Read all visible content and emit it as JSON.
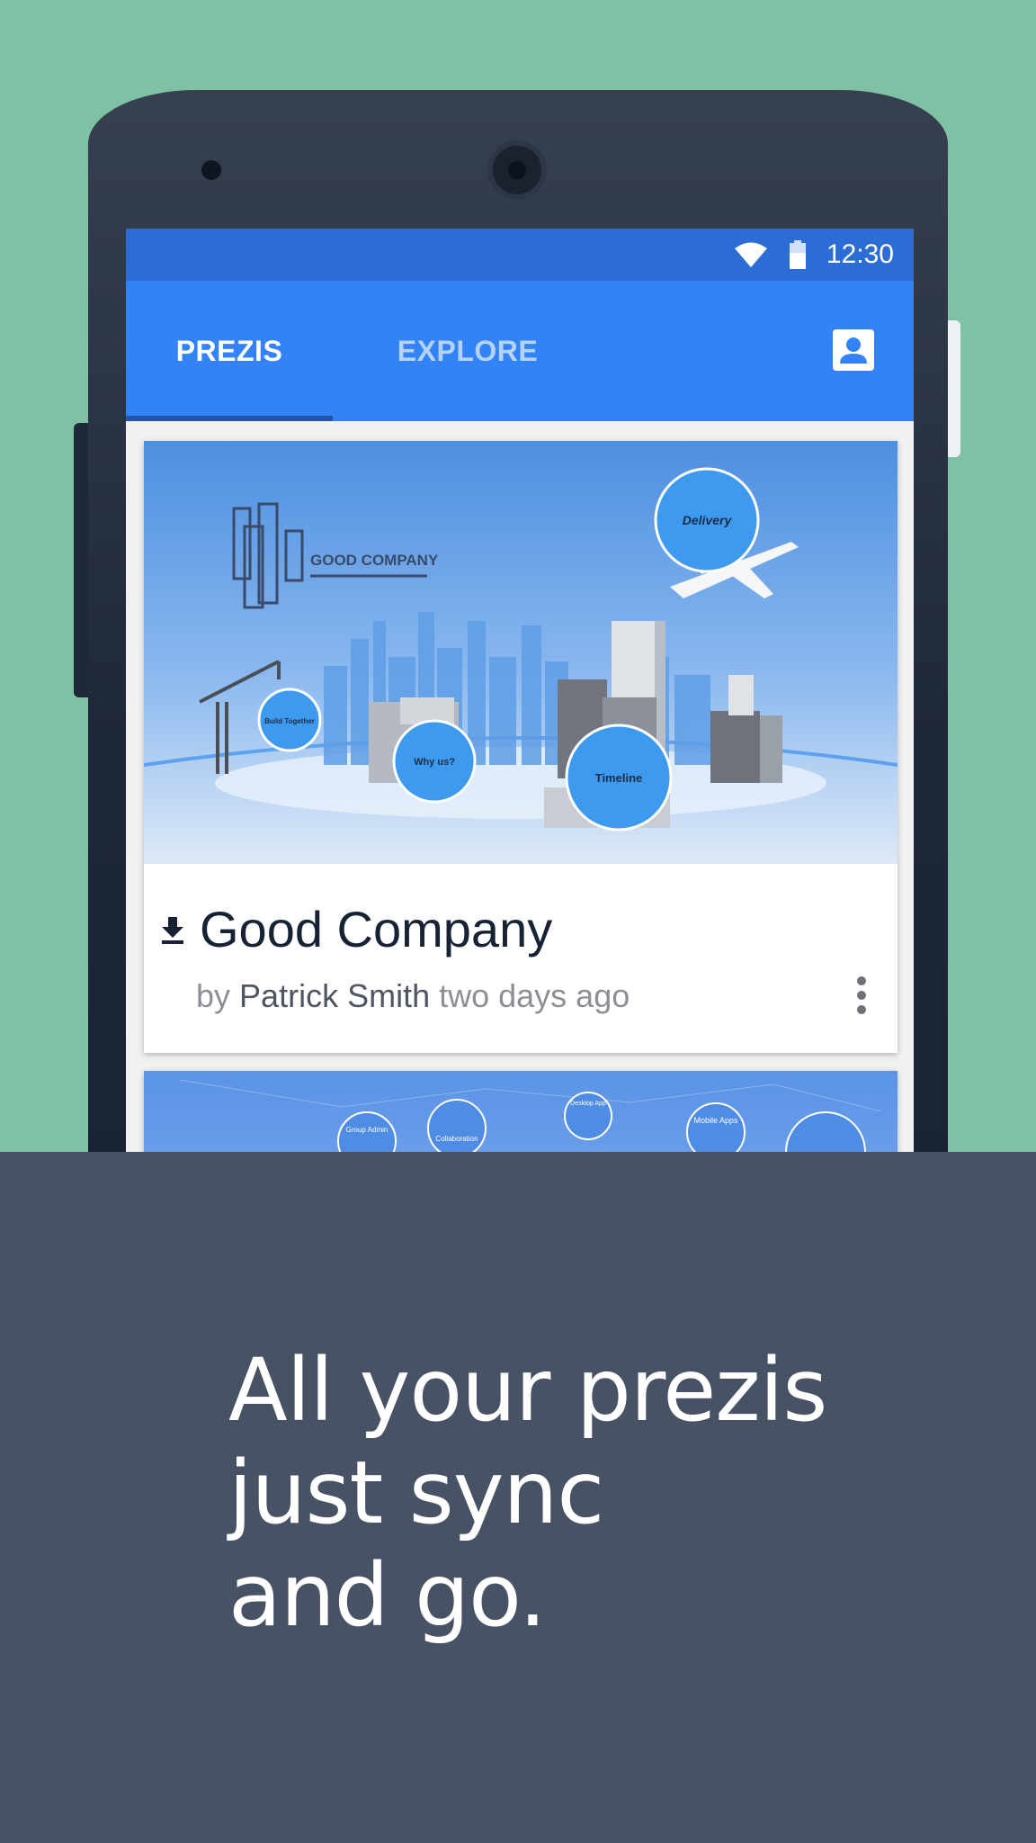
{
  "status_bar": {
    "time": "12:30",
    "icons": [
      "wifi-icon",
      "battery-icon"
    ]
  },
  "tabs": [
    {
      "label": "PREZIS",
      "active": true
    },
    {
      "label": "EXPLORE",
      "active": false
    }
  ],
  "app_bar": {
    "account_icon": "account-box-icon"
  },
  "card": {
    "title": "Good Company",
    "by": "by",
    "author": "Patrick Smith",
    "when": "two days ago",
    "thumbnail_labels": {
      "company": "GOOD COMPANY",
      "delivery": "Delivery",
      "build": "Build Together",
      "why": "Why us?",
      "timeline": "Timeline"
    }
  },
  "card2": {
    "thumbnail_labels": [
      "Group Admin",
      "Collaboration",
      "Desktop App",
      "Mobile Apps"
    ]
  },
  "tagline": {
    "lines": [
      "All your prezis",
      "just sync",
      "and go."
    ]
  },
  "colors": {
    "background": "#7ec1a4",
    "status_bar": "#2c6dd5",
    "app_bar": "#3383f6",
    "panel": "#475264"
  }
}
